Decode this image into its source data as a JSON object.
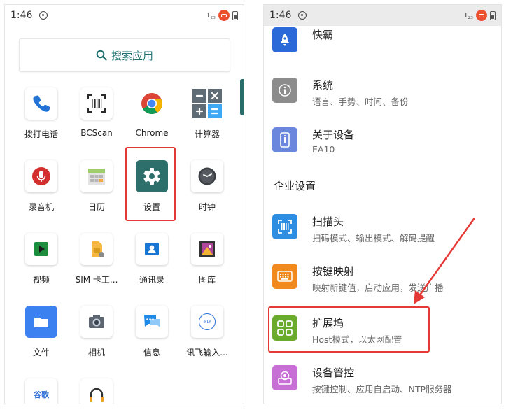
{
  "left_screen": {
    "status": {
      "time": "1:46",
      "badge": "1₂₃"
    },
    "search": {
      "label": "搜索应用",
      "icon": "search-icon",
      "color": "#1f6f6f"
    },
    "apps": [
      {
        "label": "拨打电话",
        "icon": "phone-icon"
      },
      {
        "label": "BCScan",
        "icon": "barcode-scan-icon"
      },
      {
        "label": "Chrome",
        "icon": "chrome-icon"
      },
      {
        "label": "计算器",
        "icon": "calculator-icon"
      },
      {
        "label": "录音机",
        "icon": "microphone-icon"
      },
      {
        "label": "日历",
        "icon": "calendar-icon"
      },
      {
        "label": "设置",
        "icon": "gear-icon"
      },
      {
        "label": "时钟",
        "icon": "clock-icon"
      },
      {
        "label": "视频",
        "icon": "video-play-icon"
      },
      {
        "label": "SIM 卡工...",
        "icon": "sim-card-icon"
      },
      {
        "label": "通讯录",
        "icon": "contacts-icon"
      },
      {
        "label": "图库",
        "icon": "gallery-icon"
      },
      {
        "label": "文件",
        "icon": "folder-icon"
      },
      {
        "label": "相机",
        "icon": "camera-icon"
      },
      {
        "label": "信息",
        "icon": "message-icon"
      },
      {
        "label": "讯飞输入...",
        "icon": "ifly-icon"
      }
    ],
    "partial_icon_text": "谷歌",
    "iflytek_text": "iFLY"
  },
  "right_screen": {
    "status": {
      "time": "1:46",
      "badge": "1₂₃"
    },
    "settings": [
      {
        "title": "快霸",
        "subtitle": "",
        "icon": "rocket-icon",
        "color": "#2b68d8"
      },
      {
        "title": "系统",
        "subtitle": "语言、手势、时间、备份",
        "icon": "info-icon",
        "color": "#8c8c8c"
      },
      {
        "title": "关于设备",
        "subtitle": "EA10",
        "icon": "device-icon",
        "color": "#6a86dd"
      },
      {
        "title": "扫描头",
        "subtitle": "扫码模式、输出模式、解码提醒",
        "icon": "scan-head-icon",
        "color": "#2d8de0"
      },
      {
        "title": "按键映射",
        "subtitle": "映射新键值，启动应用，发送广播",
        "icon": "keyboard-icon",
        "color": "#f08a1e"
      },
      {
        "title": "扩展坞",
        "subtitle": "Host模式，以太网配置",
        "icon": "dock-icon",
        "color": "#6aab2e"
      },
      {
        "title": "设备管控",
        "subtitle": "按键控制、应用自启动、NTP服务器",
        "icon": "device-control-icon",
        "color": "#c86fd6"
      }
    ],
    "section_header": "企业设置"
  },
  "annotation_color": "#e53935"
}
